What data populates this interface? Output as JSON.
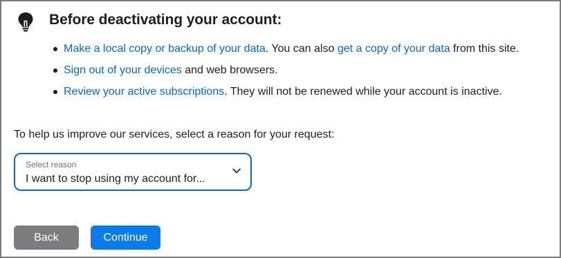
{
  "heading": "Before deactivating your account:",
  "tips": [
    {
      "link": "Make a local copy or backup of your data",
      "text1": ". You can also ",
      "link2": "get a copy of your data",
      "text2": " from this site."
    },
    {
      "link": "Sign out of your devices",
      "text1": " and web browsers."
    },
    {
      "link": "Review your active subscriptions",
      "text1": ". They will not be renewed while your account is inactive."
    }
  ],
  "reason_prompt": "To help us improve our services, select a reason for your request:",
  "reason_select": {
    "label": "Select reason",
    "value": "I want to stop using my account for..."
  },
  "buttons": {
    "back": "Back",
    "continue": "Continue"
  },
  "colors": {
    "link": "#0b66c3",
    "primary_button": "#0a7ce8",
    "secondary_button": "#7d7d80"
  },
  "icons": {
    "header": "lightbulb-icon",
    "select": "chevron-down-icon"
  }
}
